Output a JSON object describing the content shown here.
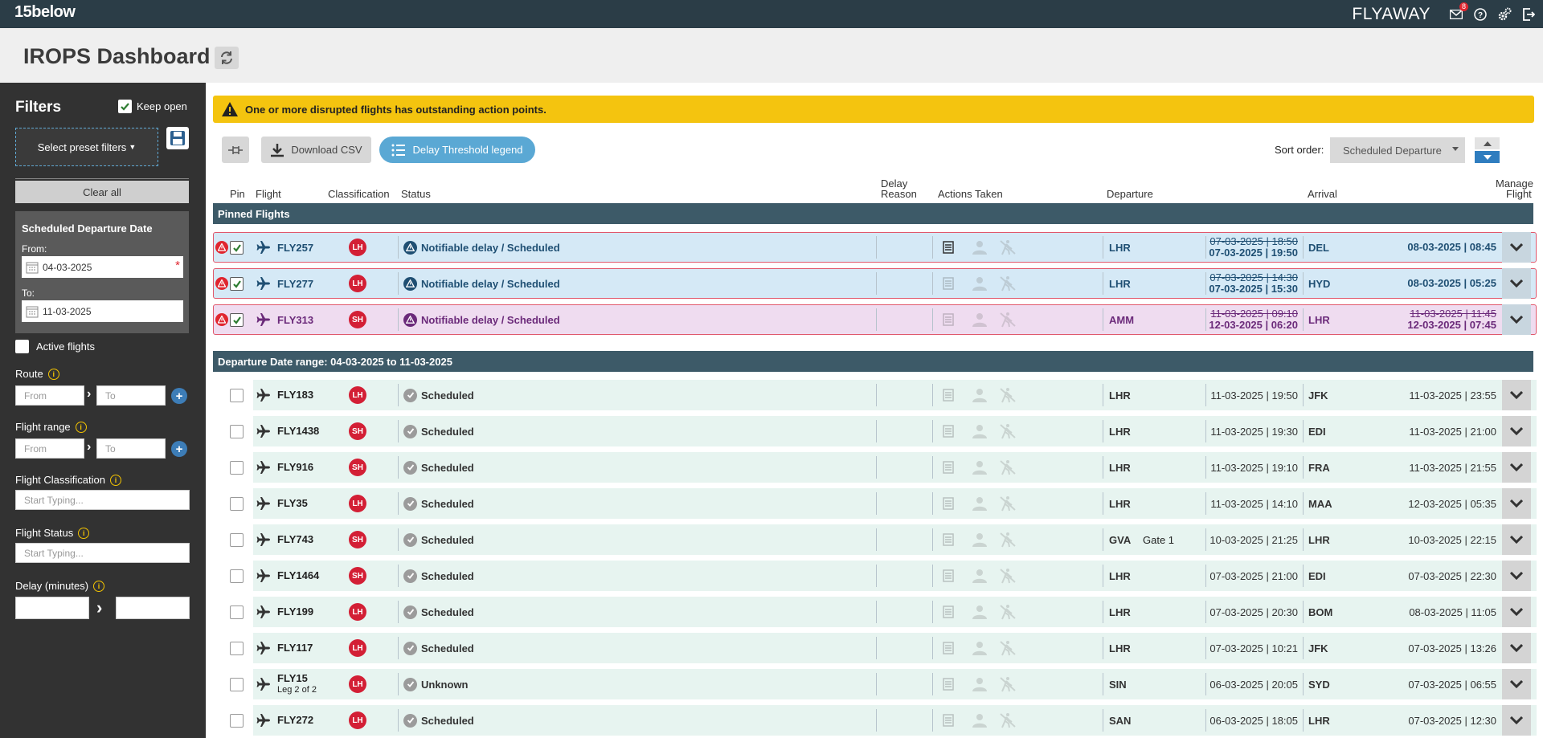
{
  "topbar": {
    "logo": "15below",
    "brand": "FLYAWAY",
    "notification_count": "8"
  },
  "page": {
    "title": "IROPS Dashboard"
  },
  "filters": {
    "title": "Filters",
    "keep_open_label": "Keep open",
    "preset_label": "Select preset filters",
    "clear_all_label": "Clear all",
    "date_section_title": "Scheduled Departure Date",
    "from_label": "From:",
    "from_value": "04-03-2025",
    "to_label": "To:",
    "to_value": "11-03-2025",
    "active_flights_label": "Active flights",
    "route_label": "Route",
    "route_from_placeholder": "From",
    "route_to_placeholder": "To",
    "flight_range_label": "Flight range",
    "range_from_placeholder": "From",
    "range_to_placeholder": "To",
    "classification_label": "Flight Classification",
    "classification_placeholder": "Start Typing...",
    "status_label": "Flight Status",
    "status_placeholder": "Start Typing...",
    "delay_label": "Delay (minutes)"
  },
  "alert": {
    "message": "One or more disrupted flights has outstanding action points."
  },
  "toolbar": {
    "download_label": "Download CSV",
    "legend_label": "Delay Threshold legend",
    "sort_label": "Sort order:",
    "sort_value": "Scheduled Departure"
  },
  "columns": {
    "pin": "Pin",
    "flight": "Flight",
    "classification": "Classification",
    "status": "Status",
    "delay_reason_1": "Delay",
    "delay_reason_2": "Reason",
    "actions": "Actions Taken",
    "departure": "Departure",
    "arrival": "Arrival",
    "manage_1": "Manage",
    "manage_2": "Flight"
  },
  "pinned_section": "Pinned Flights",
  "range_section": "Departure Date range: 04-03-2025 to 11-03-2025",
  "colors": {
    "topbar": "#2b3d47",
    "alert": "#f4c40f",
    "section": "#3d5a68",
    "pinned_blue": "#d5e9f6",
    "pinned_pink": "#efdcf0",
    "row": "#e7f4f0",
    "classification": "#d31f35",
    "accent": "#2f7dbf"
  },
  "pinned_flights": [
    {
      "flight": "FLY257",
      "cls": "LH",
      "status": "Notifiable delay / Scheduled",
      "dep": "LHR",
      "dep_old": "07-03-2025 | 18:50",
      "dep_new": "07-03-2025 | 19:50",
      "arr": "DEL",
      "arr_old": "",
      "arr_new": "08-03-2025 | 08:45",
      "tone": "blue",
      "actions_active": true
    },
    {
      "flight": "FLY277",
      "cls": "LH",
      "status": "Notifiable delay / Scheduled",
      "dep": "LHR",
      "dep_old": "07-03-2025 | 14:30",
      "dep_new": "07-03-2025 | 15:30",
      "arr": "HYD",
      "arr_old": "",
      "arr_new": "08-03-2025 | 05:25",
      "tone": "blue",
      "actions_active": false
    },
    {
      "flight": "FLY313",
      "cls": "SH",
      "status": "Notifiable delay / Scheduled",
      "dep": "AMM",
      "dep_old": "11-03-2025 | 09:10",
      "dep_new": "12-03-2025 | 06:20",
      "arr": "LHR",
      "arr_old": "11-03-2025 | 11:45",
      "arr_new": "12-03-2025 | 07:45",
      "tone": "pink",
      "actions_active": false
    }
  ],
  "flights": [
    {
      "flight": "FLY183",
      "sub": "",
      "cls": "LH",
      "status": "Scheduled",
      "dep": "LHR",
      "gate": "",
      "dep_time": "11-03-2025 | 19:50",
      "arr": "JFK",
      "arr_time": "11-03-2025 | 23:55"
    },
    {
      "flight": "FLY1438",
      "sub": "",
      "cls": "SH",
      "status": "Scheduled",
      "dep": "LHR",
      "gate": "",
      "dep_time": "11-03-2025 | 19:30",
      "arr": "EDI",
      "arr_time": "11-03-2025 | 21:00"
    },
    {
      "flight": "FLY916",
      "sub": "",
      "cls": "SH",
      "status": "Scheduled",
      "dep": "LHR",
      "gate": "",
      "dep_time": "11-03-2025 | 19:10",
      "arr": "FRA",
      "arr_time": "11-03-2025 | 21:55"
    },
    {
      "flight": "FLY35",
      "sub": "",
      "cls": "LH",
      "status": "Scheduled",
      "dep": "LHR",
      "gate": "",
      "dep_time": "11-03-2025 | 14:10",
      "arr": "MAA",
      "arr_time": "12-03-2025 | 05:35"
    },
    {
      "flight": "FLY743",
      "sub": "",
      "cls": "SH",
      "status": "Scheduled",
      "dep": "GVA",
      "gate": "Gate 1",
      "dep_time": "10-03-2025 | 21:25",
      "arr": "LHR",
      "arr_time": "10-03-2025 | 22:15"
    },
    {
      "flight": "FLY1464",
      "sub": "",
      "cls": "SH",
      "status": "Scheduled",
      "dep": "LHR",
      "gate": "",
      "dep_time": "07-03-2025 | 21:00",
      "arr": "EDI",
      "arr_time": "07-03-2025 | 22:30"
    },
    {
      "flight": "FLY199",
      "sub": "",
      "cls": "LH",
      "status": "Scheduled",
      "dep": "LHR",
      "gate": "",
      "dep_time": "07-03-2025 | 20:30",
      "arr": "BOM",
      "arr_time": "08-03-2025 | 11:05"
    },
    {
      "flight": "FLY117",
      "sub": "",
      "cls": "LH",
      "status": "Scheduled",
      "dep": "LHR",
      "gate": "",
      "dep_time": "07-03-2025 | 10:21",
      "arr": "JFK",
      "arr_time": "07-03-2025 | 13:26"
    },
    {
      "flight": "FLY15",
      "sub": "Leg 2 of 2",
      "cls": "LH",
      "status": "Unknown",
      "dep": "SIN",
      "gate": "",
      "dep_time": "06-03-2025 | 20:05",
      "arr": "SYD",
      "arr_time": "07-03-2025 | 06:55"
    },
    {
      "flight": "FLY272",
      "sub": "",
      "cls": "LH",
      "status": "Scheduled",
      "dep": "SAN",
      "gate": "",
      "dep_time": "06-03-2025 | 18:05",
      "arr": "LHR",
      "arr_time": "07-03-2025 | 12:30"
    }
  ]
}
